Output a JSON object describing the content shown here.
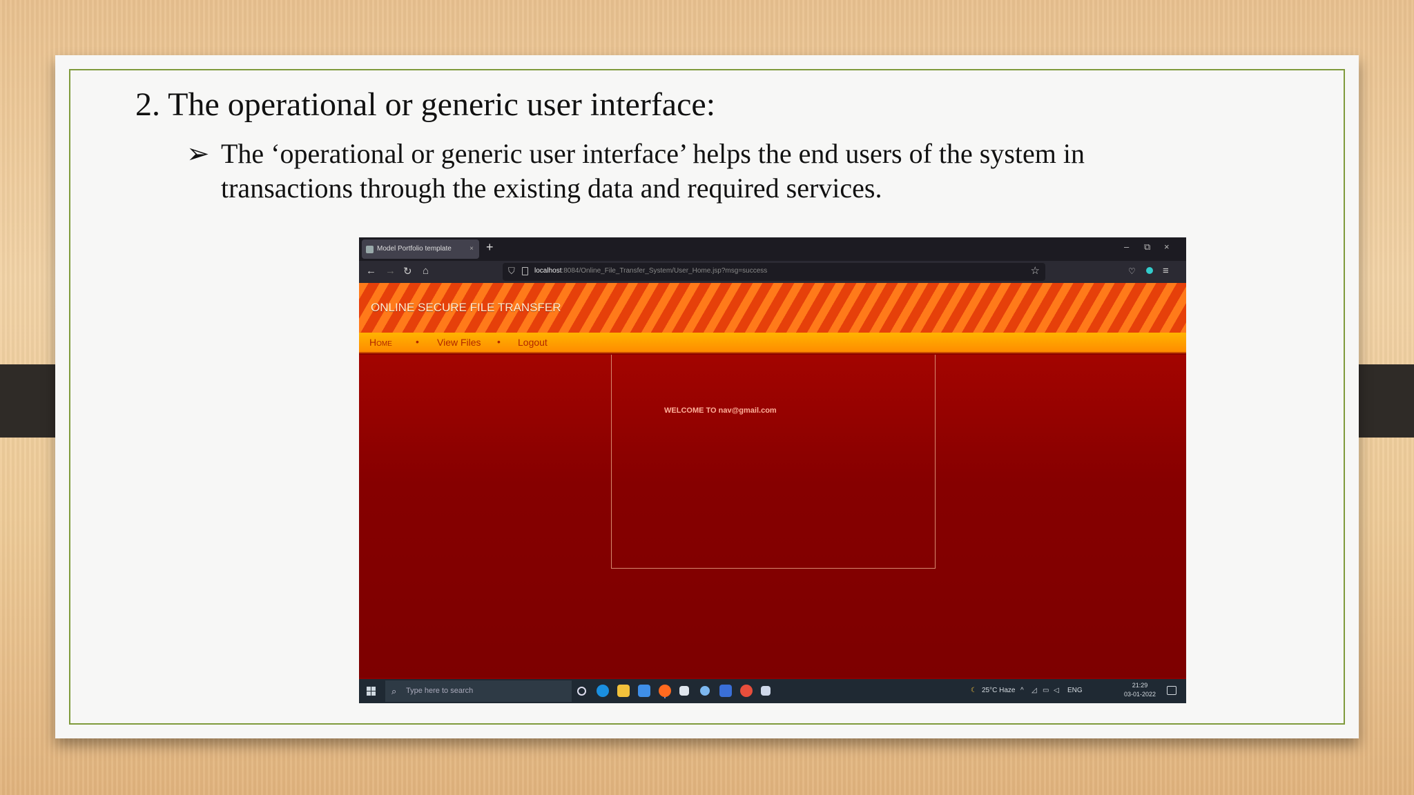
{
  "slide": {
    "title": "2. The operational or generic user interface:",
    "bullet_marker": "➢",
    "bullet_text": "The ‘operational or generic user interface’ helps the end users of the system in transactions through the existing data and required services."
  },
  "browser": {
    "tab_title": "Model Portfolio template",
    "tab_close": "×",
    "new_tab": "+",
    "win_minimize": "–",
    "win_restore": "⧉",
    "win_close": "×",
    "url_host": "localhost",
    "url_path": ":8084/Online_File_Transfer_System/User_Home.jsp?msg=success"
  },
  "site": {
    "title": "ONLINE SECURE FILE TRANSFER",
    "nav": {
      "home": "Home",
      "view_files": "View Files",
      "logout": "Logout",
      "separator": "•"
    },
    "welcome": "WELCOME TO nav@gmail.com"
  },
  "taskbar": {
    "search_placeholder": "Type here to search",
    "weather": "25°C  Haze",
    "lang": "ENG",
    "time": "21:29",
    "date": "03-01-2022"
  },
  "colors": {
    "header_orange": "#ff7a1a",
    "nav_yellow": "#ffb400",
    "content_red": "#8a0000",
    "slide_border": "#7f9a3b"
  }
}
